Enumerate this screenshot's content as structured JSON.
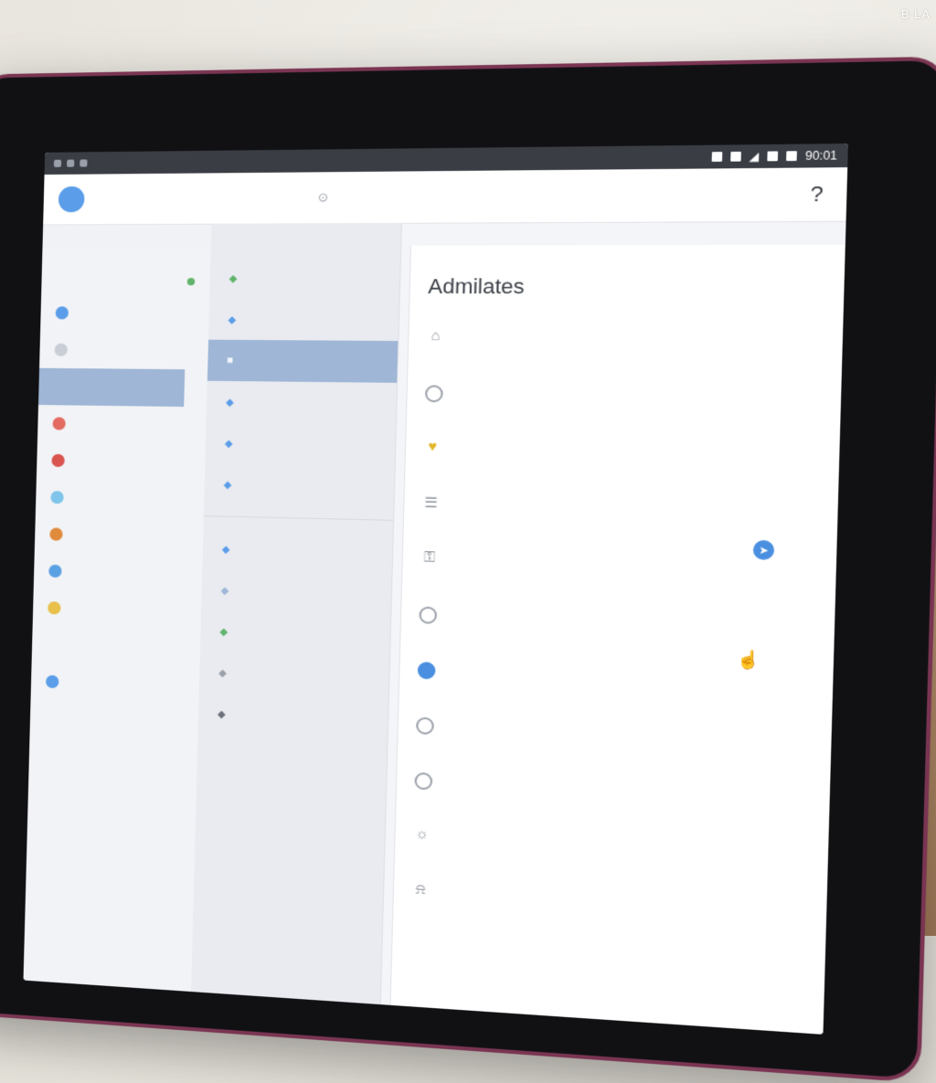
{
  "watermark": "B LA",
  "status_bar": {
    "time": "90:01"
  },
  "app_bar": {
    "help_icon": "help-icon"
  },
  "sidebar_left": {
    "items": [
      {
        "color": "#5b9de8",
        "active": false
      },
      {
        "color": "#c9ced6",
        "active": false
      },
      {
        "color": "#9fb6d6",
        "active": true
      },
      {
        "color": "#e36b62",
        "active": false
      },
      {
        "color": "#d9534f",
        "active": false
      },
      {
        "color": "#7fc4ea",
        "active": false
      },
      {
        "color": "#e08a3c",
        "active": false
      },
      {
        "color": "#5aa1e3",
        "active": false
      },
      {
        "color": "#e8c04a",
        "active": false
      }
    ]
  },
  "main": {
    "title": "Admilates",
    "settings": [
      {
        "icon": "home-icon",
        "label": "",
        "sub": ""
      },
      {
        "icon": "radio-icon",
        "label": "",
        "sub": ""
      },
      {
        "icon": "shield-icon",
        "label": "",
        "sub": ""
      },
      {
        "icon": "list-icon",
        "label": "",
        "sub": ""
      },
      {
        "icon": "lock-icon",
        "label": "",
        "sub": ""
      },
      {
        "icon": "radio-icon",
        "label": "",
        "sub": ""
      },
      {
        "icon": "radio-selected-icon",
        "label": "",
        "sub": ""
      },
      {
        "icon": "radio-icon",
        "label": "",
        "sub": ""
      },
      {
        "icon": "radio-icon",
        "label": "",
        "sub": ""
      },
      {
        "icon": "bulb-icon",
        "label": "",
        "sub": ""
      },
      {
        "icon": "bell-icon",
        "label": "",
        "sub": ""
      }
    ]
  },
  "colors": {
    "accent": "#4a8fe0",
    "selection": "#9fb6d6",
    "bezel": "#7a3552"
  }
}
